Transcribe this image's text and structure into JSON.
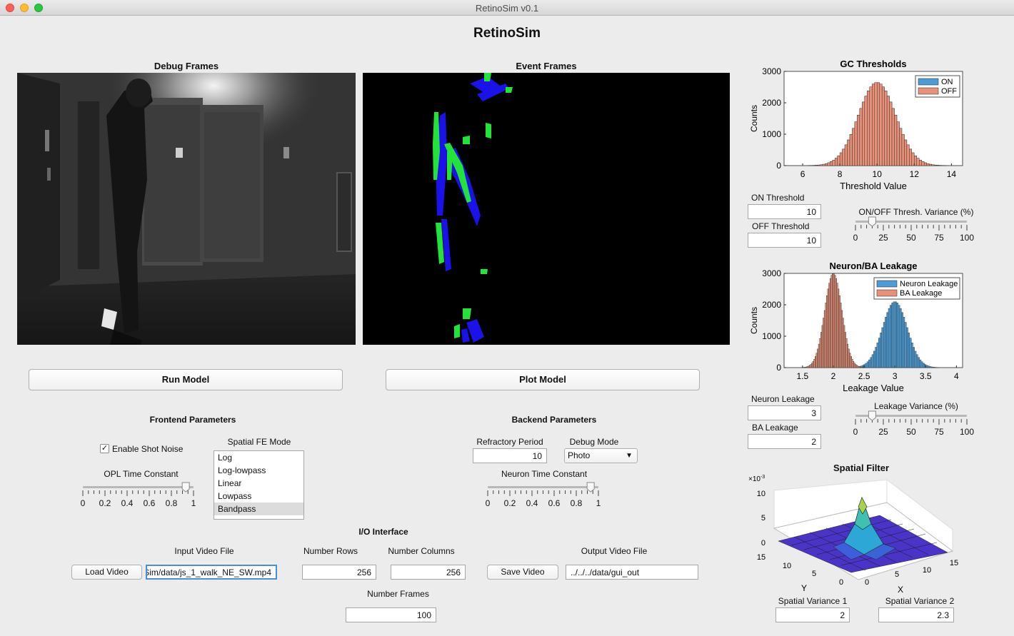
{
  "window": {
    "title": "RetinoSim v0.1"
  },
  "app": {
    "title": "RetinoSim"
  },
  "panels": {
    "debug_frames": "Debug Frames",
    "event_frames": "Event Frames"
  },
  "buttons": {
    "run_model": "Run Model",
    "plot_model": "Plot Model",
    "load_video": "Load Video",
    "save_video": "Save Video"
  },
  "frontend": {
    "title": "Frontend Parameters",
    "shot_noise_label": "Enable Shot Noise",
    "shot_noise_checked": true,
    "spatial_mode_label": "Spatial FE Mode",
    "spatial_modes": [
      "Log",
      "Log-lowpass",
      "Linear",
      "Lowpass",
      "Bandpass"
    ],
    "spatial_mode_selected": "Bandpass",
    "opl_label": "OPL Time Constant",
    "opl_value": 0.93,
    "opl_ticks": [
      "0",
      "0.2",
      "0.4",
      "0.6",
      "0.8",
      "1"
    ]
  },
  "backend": {
    "title": "Backend Parameters",
    "refractory_label": "Refractory Period",
    "refractory_value": "10",
    "debug_mode_label": "Debug Mode",
    "debug_mode_value": "Photo",
    "neuron_tc_label": "Neuron Time Constant",
    "neuron_tc_value": 0.93,
    "neuron_tc_ticks": [
      "0",
      "0.2",
      "0.4",
      "0.6",
      "0.8",
      "1"
    ]
  },
  "io": {
    "title": "I/O Interface",
    "input_label": "Input Video File",
    "input_value": "Sim/data/js_1_walk_NE_SW.mp4",
    "rows_label": "Number Rows",
    "rows_value": "256",
    "cols_label": "Number Columns",
    "cols_value": "256",
    "frames_label": "Number Frames",
    "frames_value": "100",
    "output_label": "Output Video File",
    "output_value": "../../../data/gui_out"
  },
  "thresholds": {
    "on_label": "ON Threshold",
    "on_value": "10",
    "off_label": "OFF Threshold",
    "off_value": "10",
    "variance_label": "ON/OFF Thresh. Variance (%)",
    "variance_value": 15,
    "variance_ticks": [
      "0",
      "25",
      "50",
      "75",
      "100"
    ]
  },
  "leakage": {
    "neuron_label": "Neuron Leakage",
    "neuron_value": "3",
    "ba_label": "BA Leakage",
    "ba_value": "2",
    "variance_label": "Leakage Variance (%)",
    "variance_value": 15,
    "variance_ticks": [
      "0",
      "25",
      "50",
      "75",
      "100"
    ]
  },
  "spatial": {
    "title": "Spatial Filter",
    "var1_label": "Spatial Variance 1",
    "var1_value": "2",
    "var2_label": "Spatial Variance 2",
    "var2_value": "2.3",
    "exponent_label": "×10",
    "exponent": "-3",
    "z_ticks": [
      "10",
      "5",
      "0"
    ],
    "y_ticks": [
      "15",
      "10",
      "5",
      "0"
    ],
    "x_ticks": [
      "0",
      "5",
      "10",
      "15"
    ],
    "xlabel": "X",
    "ylabel": "Y"
  },
  "colors": {
    "on_hist": "#4f9bd3",
    "off_hist": "#e8917a",
    "event_green": "#22e33a",
    "event_blue": "#1a12e8"
  },
  "chart_data": [
    {
      "type": "bar",
      "title": "GC Thresholds",
      "xlabel": "Threshold Value",
      "ylabel": "Counts",
      "xlim": [
        5,
        14.6
      ],
      "ylim": [
        0,
        3000
      ],
      "xticks": [
        "6",
        "8",
        "10",
        "12",
        "14"
      ],
      "yticks": [
        "0",
        "1000",
        "2000",
        "3000"
      ],
      "legend": "top-right",
      "series": [
        {
          "name": "ON",
          "mean": 10,
          "sd": 1.0,
          "peak": 2650,
          "color": "#4f9bd3"
        },
        {
          "name": "OFF",
          "mean": 10,
          "sd": 1.0,
          "peak": 2650,
          "color": "#e8917a"
        }
      ]
    },
    {
      "type": "bar",
      "title": "Neuron/BA Leakage",
      "xlabel": "Leakage Value",
      "ylabel": "Counts",
      "xlim": [
        1.2,
        4.1
      ],
      "ylim": [
        0,
        3000
      ],
      "xticks": [
        "1.5",
        "2",
        "2.5",
        "3",
        "3.5",
        "4"
      ],
      "yticks": [
        "0",
        "1000",
        "2000",
        "3000"
      ],
      "legend": "top-right",
      "series": [
        {
          "name": "Neuron Leakage",
          "mean": 3,
          "sd": 0.2,
          "peak": 2100,
          "color": "#4f9bd3"
        },
        {
          "name": "BA Leakage",
          "mean": 2,
          "sd": 0.14,
          "peak": 3000,
          "color": "#e8917a"
        }
      ]
    }
  ]
}
